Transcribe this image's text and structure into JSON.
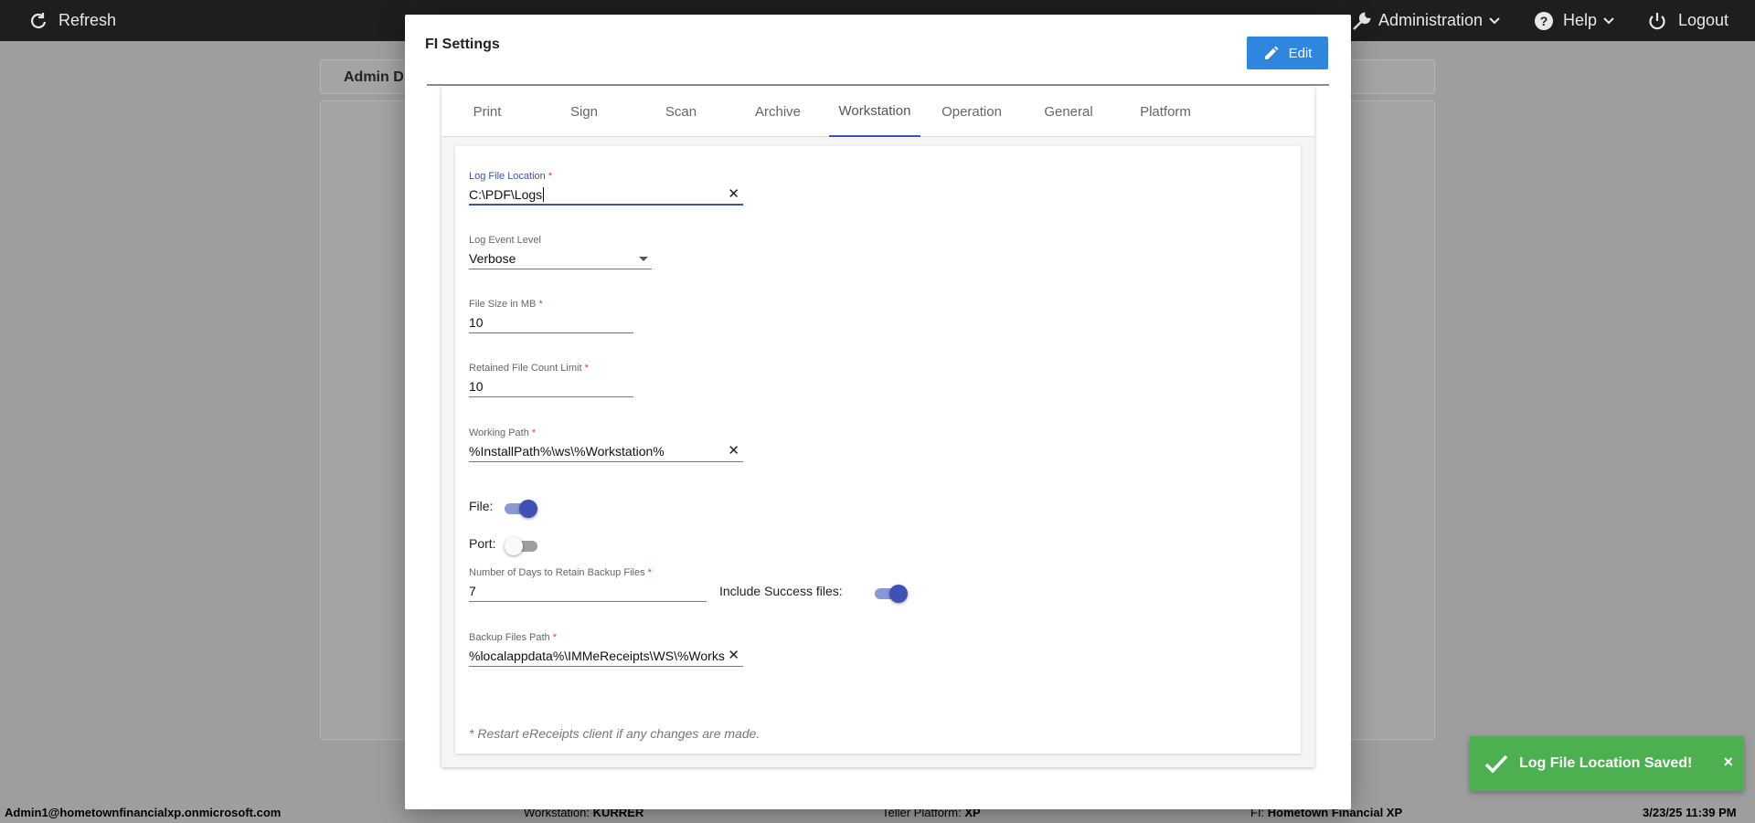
{
  "topbar": {
    "refresh": "Refresh",
    "administration": "Administration",
    "help": "Help",
    "logout": "Logout"
  },
  "background": {
    "header_title": "Admin D"
  },
  "statusbar": {
    "user": "Admin1@hometownfinancialxp.onmicrosoft.com",
    "workstation_label": "Workstation:",
    "workstation_value": "KURRER",
    "teller_label": "Teller Platform:",
    "teller_value": "XP",
    "fi_label": "FI:",
    "fi_value": "Hometown Financial XP",
    "datetime": "3/23/25 11:39 PM"
  },
  "modal": {
    "title": "FI Settings",
    "edit_label": "Edit",
    "tabs": [
      {
        "label": "Print"
      },
      {
        "label": "Sign"
      },
      {
        "label": "Scan"
      },
      {
        "label": "Archive"
      },
      {
        "label": "Workstation"
      },
      {
        "label": "Operation"
      },
      {
        "label": "General"
      },
      {
        "label": "Platform"
      }
    ],
    "active_tab": "Workstation",
    "form": {
      "log_file_location": {
        "label": "Log File Location",
        "required": "*",
        "value": "C:\\PDF\\Logs"
      },
      "log_event_level": {
        "label": "Log Event Level",
        "value": "Verbose"
      },
      "file_size": {
        "label": "File Size in MB",
        "required": "*",
        "value": "10"
      },
      "retained_count": {
        "label": "Retained File Count Limit",
        "required": "*",
        "value": "10"
      },
      "working_path": {
        "label": "Working Path",
        "required": "*",
        "value": "%InstallPath%\\ws\\%Workstation%"
      },
      "file_toggle": {
        "label": "File:",
        "on": true
      },
      "port_toggle": {
        "label": "Port:",
        "on": false
      },
      "backup_days": {
        "label": "Number of Days to Retain Backup Files",
        "required": "*",
        "value": "7"
      },
      "include_success": {
        "label": "Include Success files:",
        "on": true
      },
      "backup_path": {
        "label": "Backup Files Path",
        "required": "*",
        "value": "%localappdata%\\IMMeReceipts\\WS\\%Works"
      },
      "note": "* Restart eReceipts client if any changes are made."
    }
  },
  "toast": {
    "message": "Log File Location Saved!",
    "close": "×"
  },
  "colors": {
    "accent": "#3f51b5",
    "edit_button": "#2e86de",
    "toast": "#4caf50",
    "topbar": "#1e1e1e"
  }
}
